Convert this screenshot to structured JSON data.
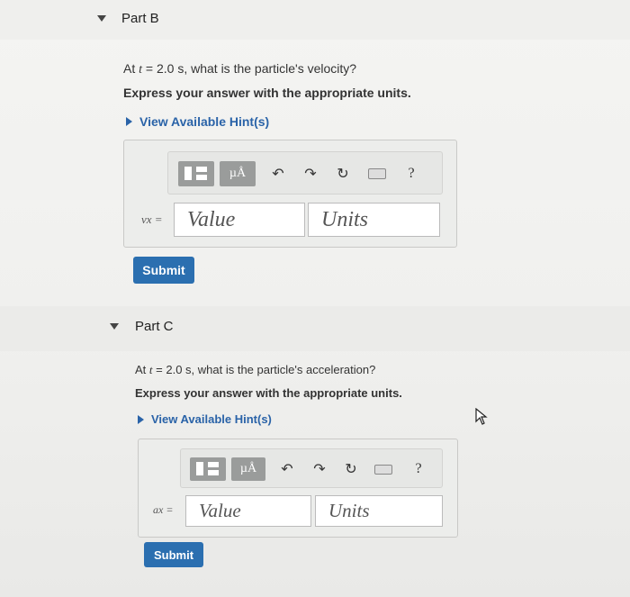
{
  "parts": [
    {
      "title": "Part B",
      "question_prefix": "At ",
      "question_var": "t",
      "question_rest": " = 2.0 s, what is the particle's velocity?",
      "instructions": "Express your answer with the appropriate units.",
      "hint_label": "View Available Hint(s)",
      "toolbar": {
        "units_label": "µÅ",
        "help_label": "?"
      },
      "variable_label": "vx =",
      "value_placeholder": "Value",
      "units_placeholder": "Units",
      "submit_label": "Submit"
    },
    {
      "title": "Part C",
      "question_prefix": "At ",
      "question_var": "t",
      "question_rest": " = 2.0 s, what is the particle's acceleration?",
      "instructions": "Express your answer with the appropriate units.",
      "hint_label": "View Available Hint(s)",
      "toolbar": {
        "units_label": "µÅ",
        "help_label": "?"
      },
      "variable_label": "ax =",
      "value_placeholder": "Value",
      "units_placeholder": "Units",
      "submit_label": "Submit"
    }
  ],
  "colors": {
    "accent": "#2b6fb0",
    "hint": "#2a63a8"
  }
}
